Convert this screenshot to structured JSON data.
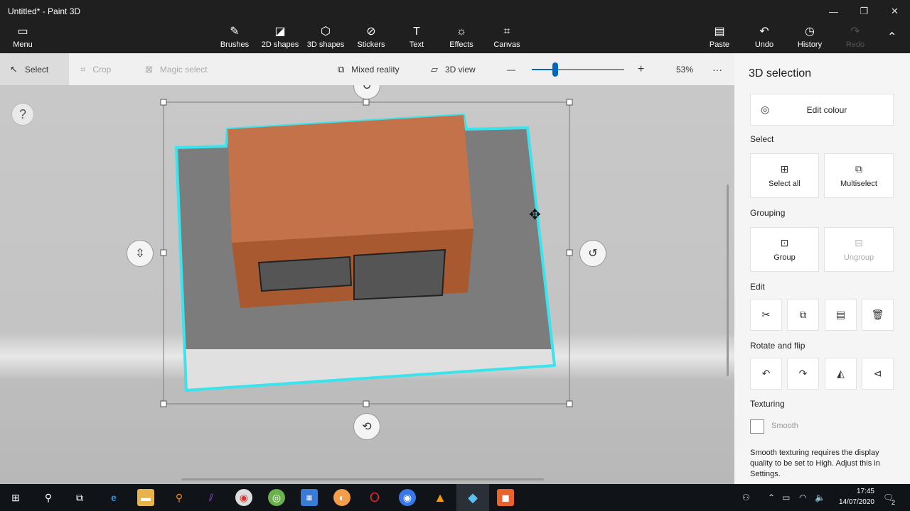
{
  "window": {
    "title": "Untitled* - Paint 3D",
    "controls": [
      "—",
      "❐",
      "✕"
    ]
  },
  "ribbon": {
    "menu": "Menu",
    "tools": [
      "Brushes",
      "2D shapes",
      "3D shapes",
      "Stickers",
      "Text",
      "Effects",
      "Canvas"
    ],
    "paste": "Paste",
    "undo": "Undo",
    "history": "History",
    "redo": "Redo"
  },
  "toolbar": {
    "select": "Select",
    "crop": "Crop",
    "magic_select": "Magic select",
    "mixed_reality": "Mixed reality",
    "view_3d": "3D view",
    "zoom_minus": "—",
    "zoom_plus": "+",
    "zoom_level": "53%",
    "zoom_fraction": 0.25,
    "more": "···"
  },
  "canvas": {
    "help": "?"
  },
  "panel": {
    "title": "3D selection",
    "edit_colour": "Edit colour",
    "select_heading": "Select",
    "select_all": "Select all",
    "multiselect": "Multiselect",
    "grouping_heading": "Grouping",
    "group": "Group",
    "ungroup": "Ungroup",
    "edit_heading": "Edit",
    "rotate_heading": "Rotate and flip",
    "texturing_heading": "Texturing",
    "smooth": "Smooth",
    "smooth_note": "Smooth texturing requires the display quality to be set to High. Adjust this in Settings."
  },
  "taskbar": {
    "time": "17:45",
    "date": "14/07/2020",
    "notifications": "2"
  },
  "colors": {
    "accent": "#0067c0",
    "selection": "#3be3ec",
    "box_top": "#c4724a",
    "box_front": "#a8592f"
  }
}
